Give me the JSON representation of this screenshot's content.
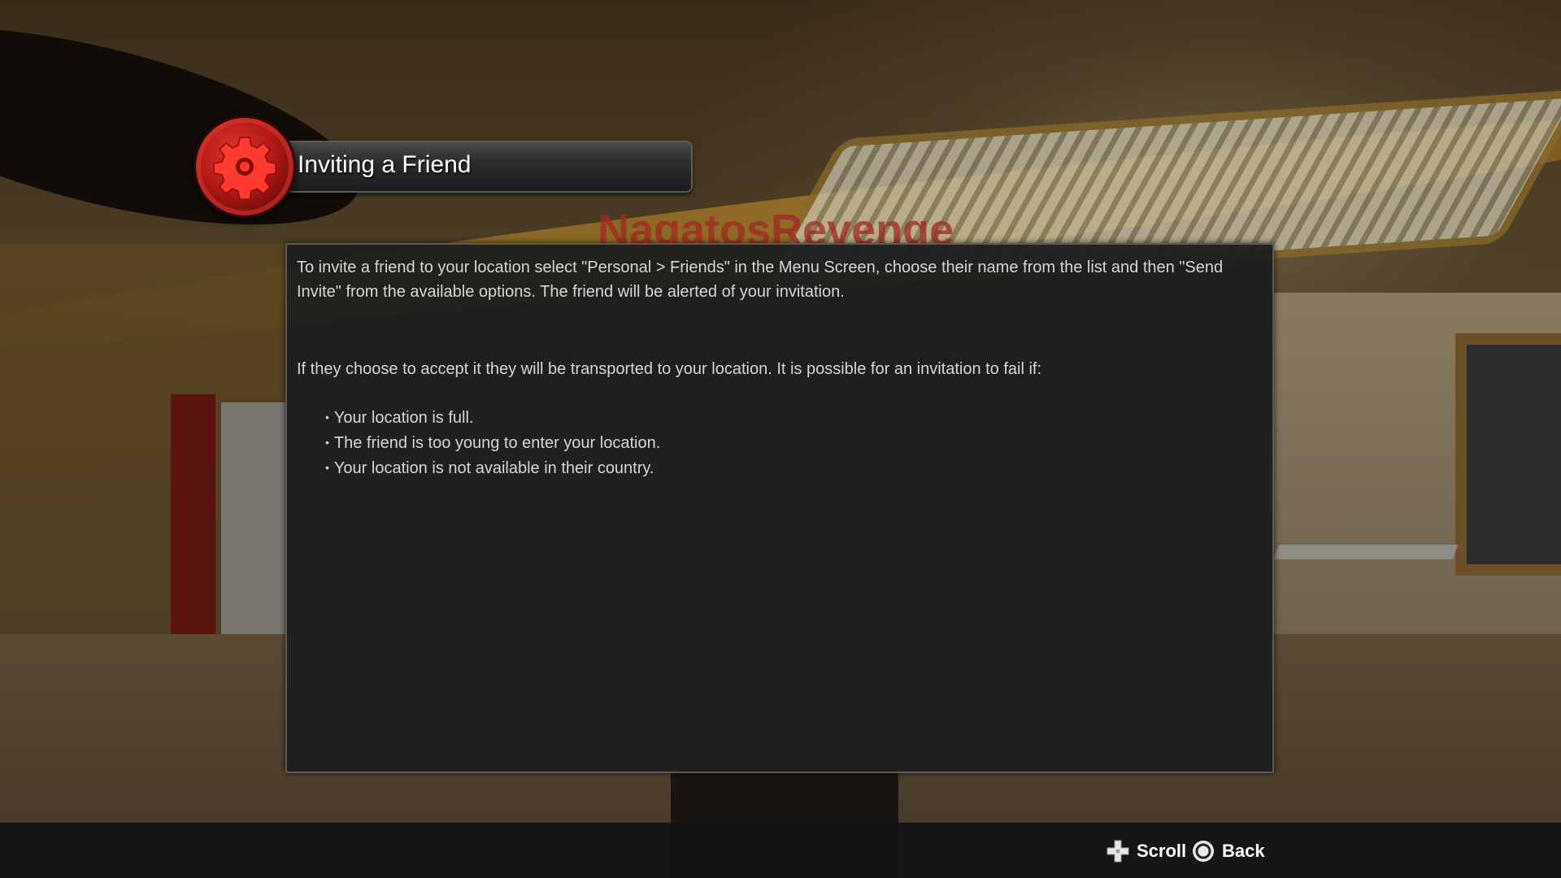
{
  "background": {
    "watermark_text": "NagatosRevenge"
  },
  "header": {
    "icon": "gear-icon",
    "title": "Inviting a Friend"
  },
  "panel": {
    "paragraph1": "To invite a friend to your location select \"Personal > Friends\" in the Menu Screen, choose their name from the list and then \"Send Invite\" from the available options.  The friend will be alerted of your invitation.",
    "paragraph2": "If they choose to accept it they will be transported to your location.  It is possible for an invitation to fail if:",
    "bullets": [
      "Your location is full.",
      "The friend is too young to enter your location.",
      "Your location is not available in their country."
    ]
  },
  "controls": {
    "scroll": {
      "icon": "dpad-icon",
      "label": "Scroll"
    },
    "back": {
      "icon": "circle-button-icon",
      "label": "Back"
    }
  },
  "colors": {
    "accent_red": "#c0201a",
    "panel_bg": "#1e1e1e",
    "text": "#d6d6d6"
  }
}
